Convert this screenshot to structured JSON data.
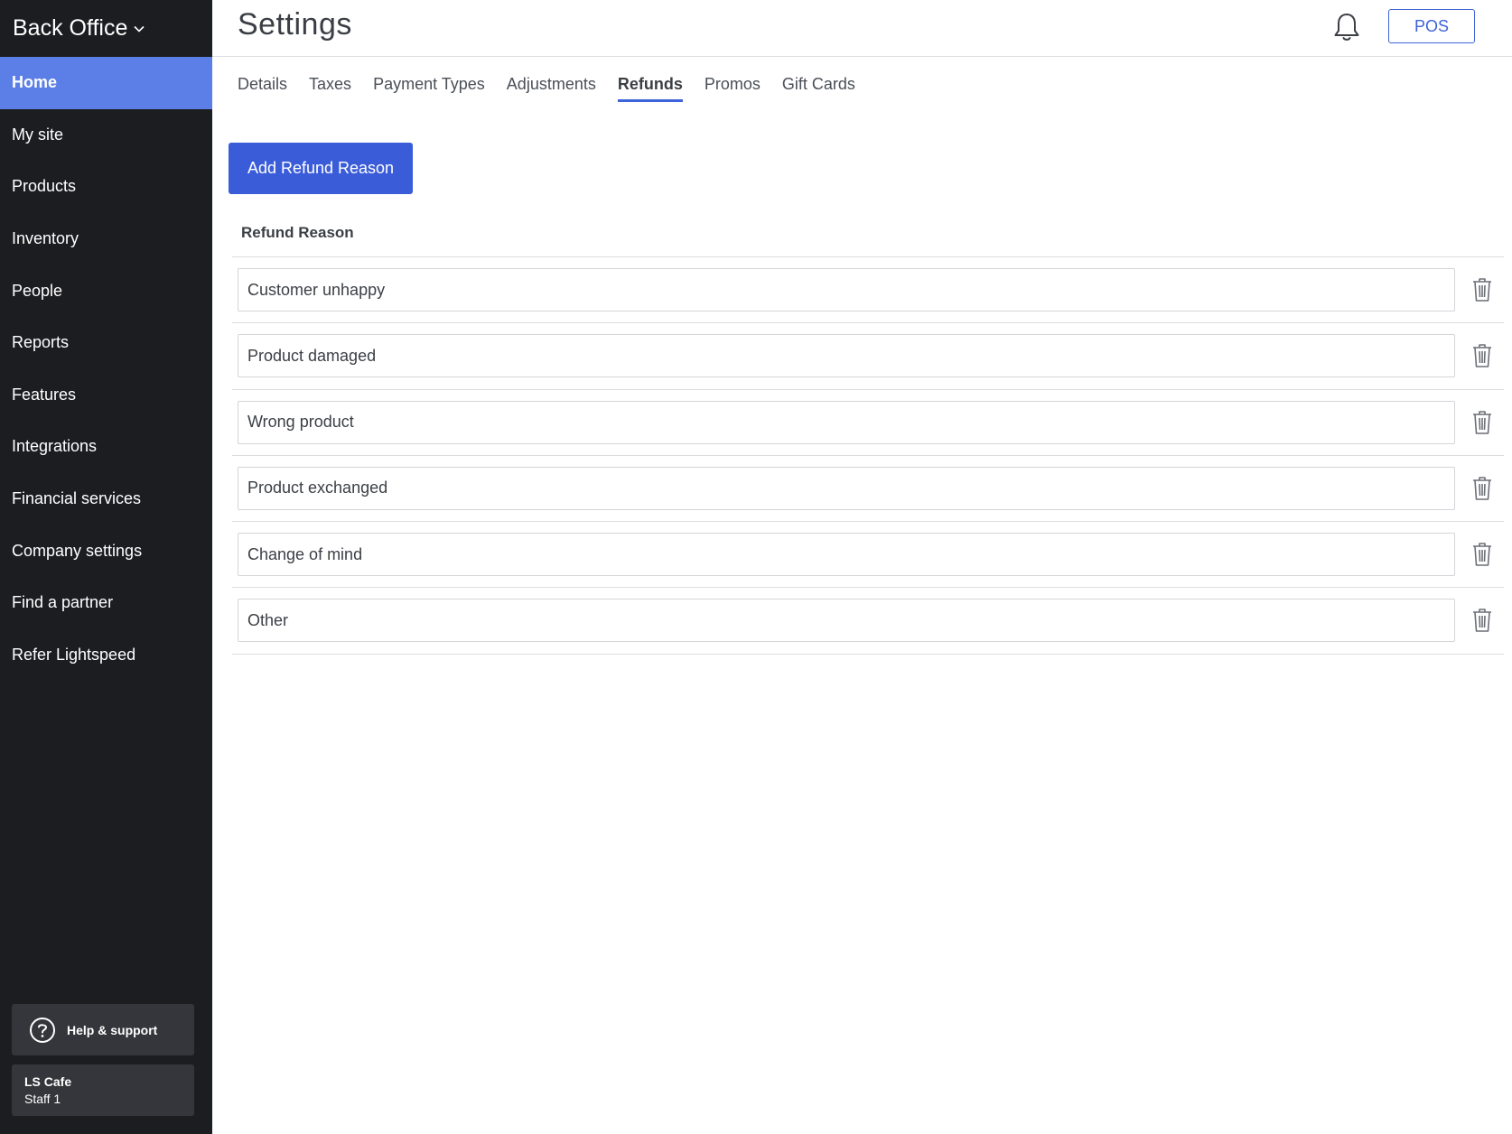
{
  "sidebar": {
    "brand": "Back Office",
    "items": [
      {
        "label": "Home",
        "active": true
      },
      {
        "label": "My site"
      },
      {
        "label": "Products"
      },
      {
        "label": "Inventory"
      },
      {
        "label": "People"
      },
      {
        "label": "Reports"
      },
      {
        "label": "Features"
      },
      {
        "label": "Integrations"
      },
      {
        "label": "Financial services"
      },
      {
        "label": "Company settings"
      },
      {
        "label": "Find a partner"
      },
      {
        "label": "Refer Lightspeed"
      }
    ],
    "help_label": "Help & support",
    "account": {
      "name": "LS Cafe",
      "role": "Staff 1"
    }
  },
  "header": {
    "title": "Settings",
    "pos_label": "POS"
  },
  "tabs": [
    {
      "label": "Details"
    },
    {
      "label": "Taxes"
    },
    {
      "label": "Payment Types"
    },
    {
      "label": "Adjustments"
    },
    {
      "label": "Refunds",
      "active": true
    },
    {
      "label": "Promos"
    },
    {
      "label": "Gift Cards"
    }
  ],
  "main": {
    "add_button_label": "Add Refund Reason",
    "column_header": "Refund Reason",
    "reasons": [
      "Customer unhappy",
      "Product damaged",
      "Wrong product",
      "Product exchanged",
      "Change of mind",
      "Other"
    ]
  },
  "colors": {
    "sidebar_bg": "#1c1d21",
    "active_nav": "#5b7fe6",
    "accent": "#3a5cd8"
  },
  "icons": {
    "brand_chevron": "chevron-down-icon",
    "bell": "bell-icon",
    "help": "question-circle-icon",
    "delete": "trash-icon"
  }
}
